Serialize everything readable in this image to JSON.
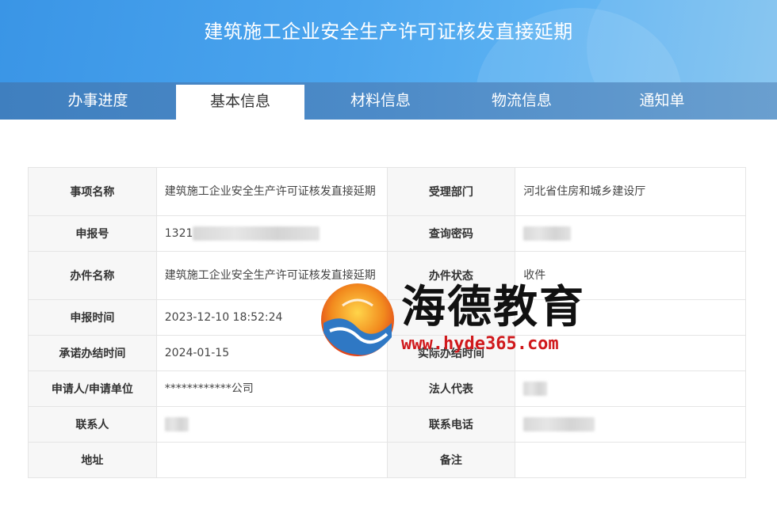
{
  "header": {
    "title": "建筑施工企业安全生产许可证核发直接延期"
  },
  "tabs": [
    {
      "label": "办事进度"
    },
    {
      "label": "基本信息"
    },
    {
      "label": "材料信息"
    },
    {
      "label": "物流信息"
    },
    {
      "label": "通知单"
    }
  ],
  "info": {
    "item_name_label": "事项名称",
    "item_name_value": "建筑施工企业安全生产许可证核发直接延期",
    "dept_label": "受理部门",
    "dept_value": "河北省住房和城乡建设厅",
    "report_no_label": "申报号",
    "report_no_value": "1321",
    "query_pwd_label": "查询密码",
    "case_name_label": "办件名称",
    "case_name_value": "建筑施工企业安全生产许可证核发直接延期",
    "status_label": "办件状态",
    "status_value": "收件",
    "report_time_label": "申报时间",
    "report_time_value": "2023-12-10 18:52:24",
    "promise_label": "承诺办结时间",
    "promise_value": "2024-01-15",
    "actual_label": "实际办结时间",
    "applicant_label": "申请人/申请单位",
    "applicant_value": "************公司",
    "legal_label": "法人代表",
    "contact_label": "联系人",
    "phone_label": "联系电话",
    "address_label": "地址",
    "remark_label": "备注"
  },
  "watermark": {
    "name": "海德教育",
    "url": "www.hyde365.com"
  },
  "colors": {
    "banner": "#4ba5ee",
    "tab_bar": "#4d8bc8",
    "label_bg": "#f7f7f7",
    "url_red": "#d0191c"
  }
}
